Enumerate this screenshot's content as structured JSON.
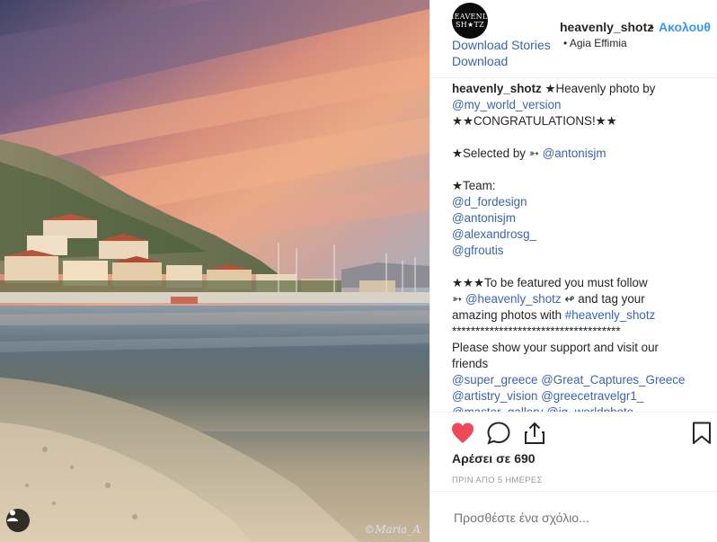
{
  "post": {
    "username": "heavenly_shotz",
    "separator": "•",
    "follow_label": "Ακολουθ",
    "avatar_top": "HEAVENLY",
    "avatar_bottom": "SH★TZ",
    "download_stories": "Download Stories",
    "download": "Download",
    "location_dot": "•",
    "location": "Agia Effimia",
    "signature": "©Maria_A",
    "caption_lines": [
      {
        "parts": [
          {
            "t": "heavenly_shotz",
            "c": "b"
          },
          {
            "t": " ★Heavenly photo by",
            "c": ""
          }
        ]
      },
      {
        "parts": [
          {
            "t": "@my_world_version",
            "c": "blue"
          }
        ]
      },
      {
        "parts": [
          {
            "t": "★★CONGRATULATIONS!★★",
            "c": ""
          }
        ]
      },
      {
        "parts": [
          {
            "t": " ",
            "c": ""
          }
        ]
      },
      {
        "parts": [
          {
            "t": "★Selected by ➳ ",
            "c": ""
          },
          {
            "t": "@antonisjm",
            "c": "blue"
          }
        ]
      },
      {
        "parts": [
          {
            "t": " ",
            "c": ""
          }
        ]
      },
      {
        "parts": [
          {
            "t": "★Team:",
            "c": ""
          }
        ]
      },
      {
        "parts": [
          {
            "t": "@d_fordesign",
            "c": "blue"
          }
        ]
      },
      {
        "parts": [
          {
            "t": "@antonisjm",
            "c": "blue"
          }
        ]
      },
      {
        "parts": [
          {
            "t": "@alexandrosg_",
            "c": "blue"
          }
        ]
      },
      {
        "parts": [
          {
            "t": "@gfroutis",
            "c": "blue"
          }
        ]
      },
      {
        "parts": [
          {
            "t": " ",
            "c": ""
          }
        ]
      },
      {
        "parts": [
          {
            "t": "★★★To be featured you must follow",
            "c": ""
          }
        ]
      },
      {
        "parts": [
          {
            "t": "➳ ",
            "c": ""
          },
          {
            "t": "@heavenly_shotz",
            "c": "blue"
          },
          {
            "t": " ↫ and tag your",
            "c": ""
          }
        ]
      },
      {
        "parts": [
          {
            "t": "amazing photos with ",
            "c": ""
          },
          {
            "t": "#heavenly_shotz",
            "c": "blue"
          }
        ]
      },
      {
        "parts": [
          {
            "t": "************************************",
            "c": ""
          }
        ]
      },
      {
        "parts": [
          {
            "t": "Please show your support and visit our",
            "c": ""
          }
        ]
      },
      {
        "parts": [
          {
            "t": "friends",
            "c": ""
          }
        ]
      },
      {
        "parts": [
          {
            "t": "@super_greece",
            "c": "blue"
          },
          {
            "t": " ",
            "c": ""
          },
          {
            "t": "@Great_Captures_Greece",
            "c": "blue"
          }
        ]
      },
      {
        "parts": [
          {
            "t": "@artistry_vision",
            "c": "blue"
          },
          {
            "t": " ",
            "c": ""
          },
          {
            "t": "@greecetravelgr1_",
            "c": "blue"
          }
        ]
      },
      {
        "parts": [
          {
            "t": "@master_gallery",
            "c": "blue"
          },
          {
            "t": " ",
            "c": ""
          },
          {
            "t": "@ig_worldphoto",
            "c": "blue"
          }
        ]
      }
    ],
    "likes": "Αρέσει σε 690",
    "time": "ΠΡΙΝ ΑΠΟ 5 ΗΜΕΡΕΣ",
    "comment_placeholder": "Προσθέστε ένα σχόλιο..."
  },
  "icons": {
    "like": "heart-icon",
    "comment": "comment-icon",
    "share": "share-icon",
    "save": "bookmark-icon",
    "tag": "user-tag-icon"
  },
  "colors": {
    "accent": "#3897f0",
    "link": "#3c64a8",
    "heart": "#ed4956"
  }
}
